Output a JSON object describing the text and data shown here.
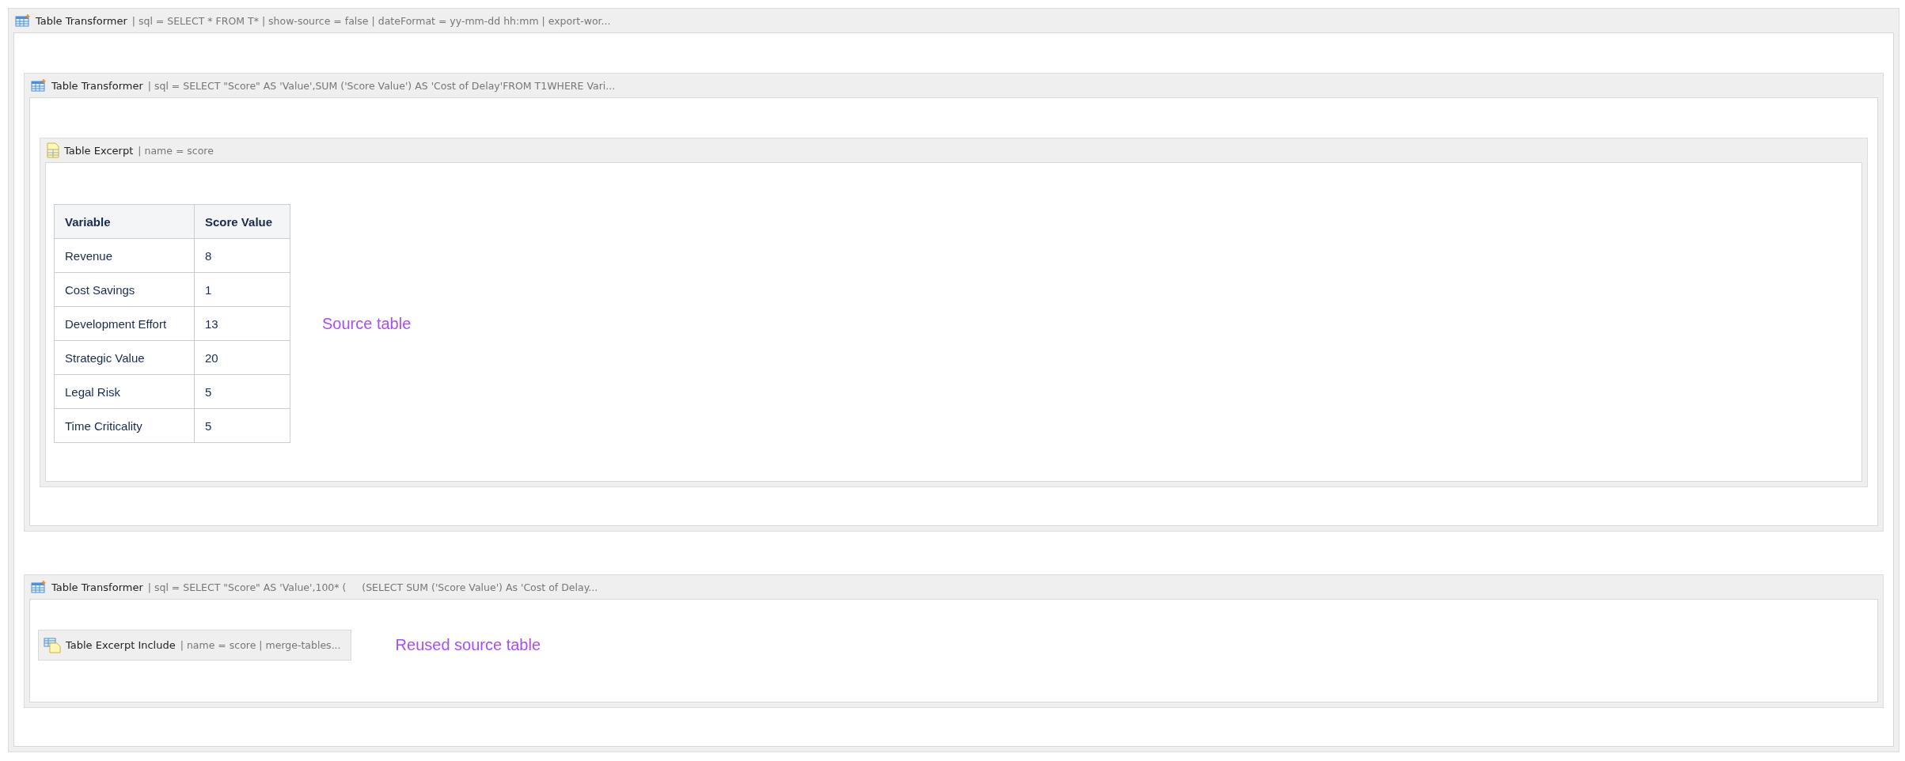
{
  "macro": {
    "kind": "transformer",
    "title": "Table Transformer",
    "params": "| sql = SELECT * FROM T* | show-source = false | dateFormat = yy-mm-dd hh:mm | export-wor...",
    "children": [
      {
        "kind": "macro",
        "macro": {
          "kind": "transformer",
          "title": "Table Transformer",
          "params": "| sql = SELECT \"Score\" AS 'Value',SUM ('Score Value') AS 'Cost of Delay'FROM T1WHERE Vari...",
          "children": [
            {
              "kind": "macro",
              "macro": {
                "kind": "excerpt",
                "title": "Table Excerpt",
                "params": "| name = score",
                "children": [
                  {
                    "kind": "table",
                    "note": "Source table",
                    "columns": [
                      "Variable",
                      "Score Value"
                    ],
                    "rows": [
                      [
                        "Revenue",
                        "8"
                      ],
                      [
                        "Cost Savings",
                        "1"
                      ],
                      [
                        "Development Effort",
                        "13"
                      ],
                      [
                        "Strategic Value",
                        "20"
                      ],
                      [
                        "Legal Risk",
                        "5"
                      ],
                      [
                        "Time Criticality",
                        "5"
                      ]
                    ]
                  }
                ]
              }
            }
          ]
        }
      },
      {
        "kind": "macro",
        "macro": {
          "kind": "transformer",
          "title": "Table Transformer",
          "params": "| sql = SELECT \"Score\" AS 'Value',100* (     (SELECT SUM ('Score Value') As 'Cost of Delay...",
          "children": [
            {
              "kind": "include",
              "title": "Table Excerpt Include",
              "params": "| name = score | merge-tables...",
              "note": "Reused source table"
            }
          ]
        }
      }
    ]
  }
}
